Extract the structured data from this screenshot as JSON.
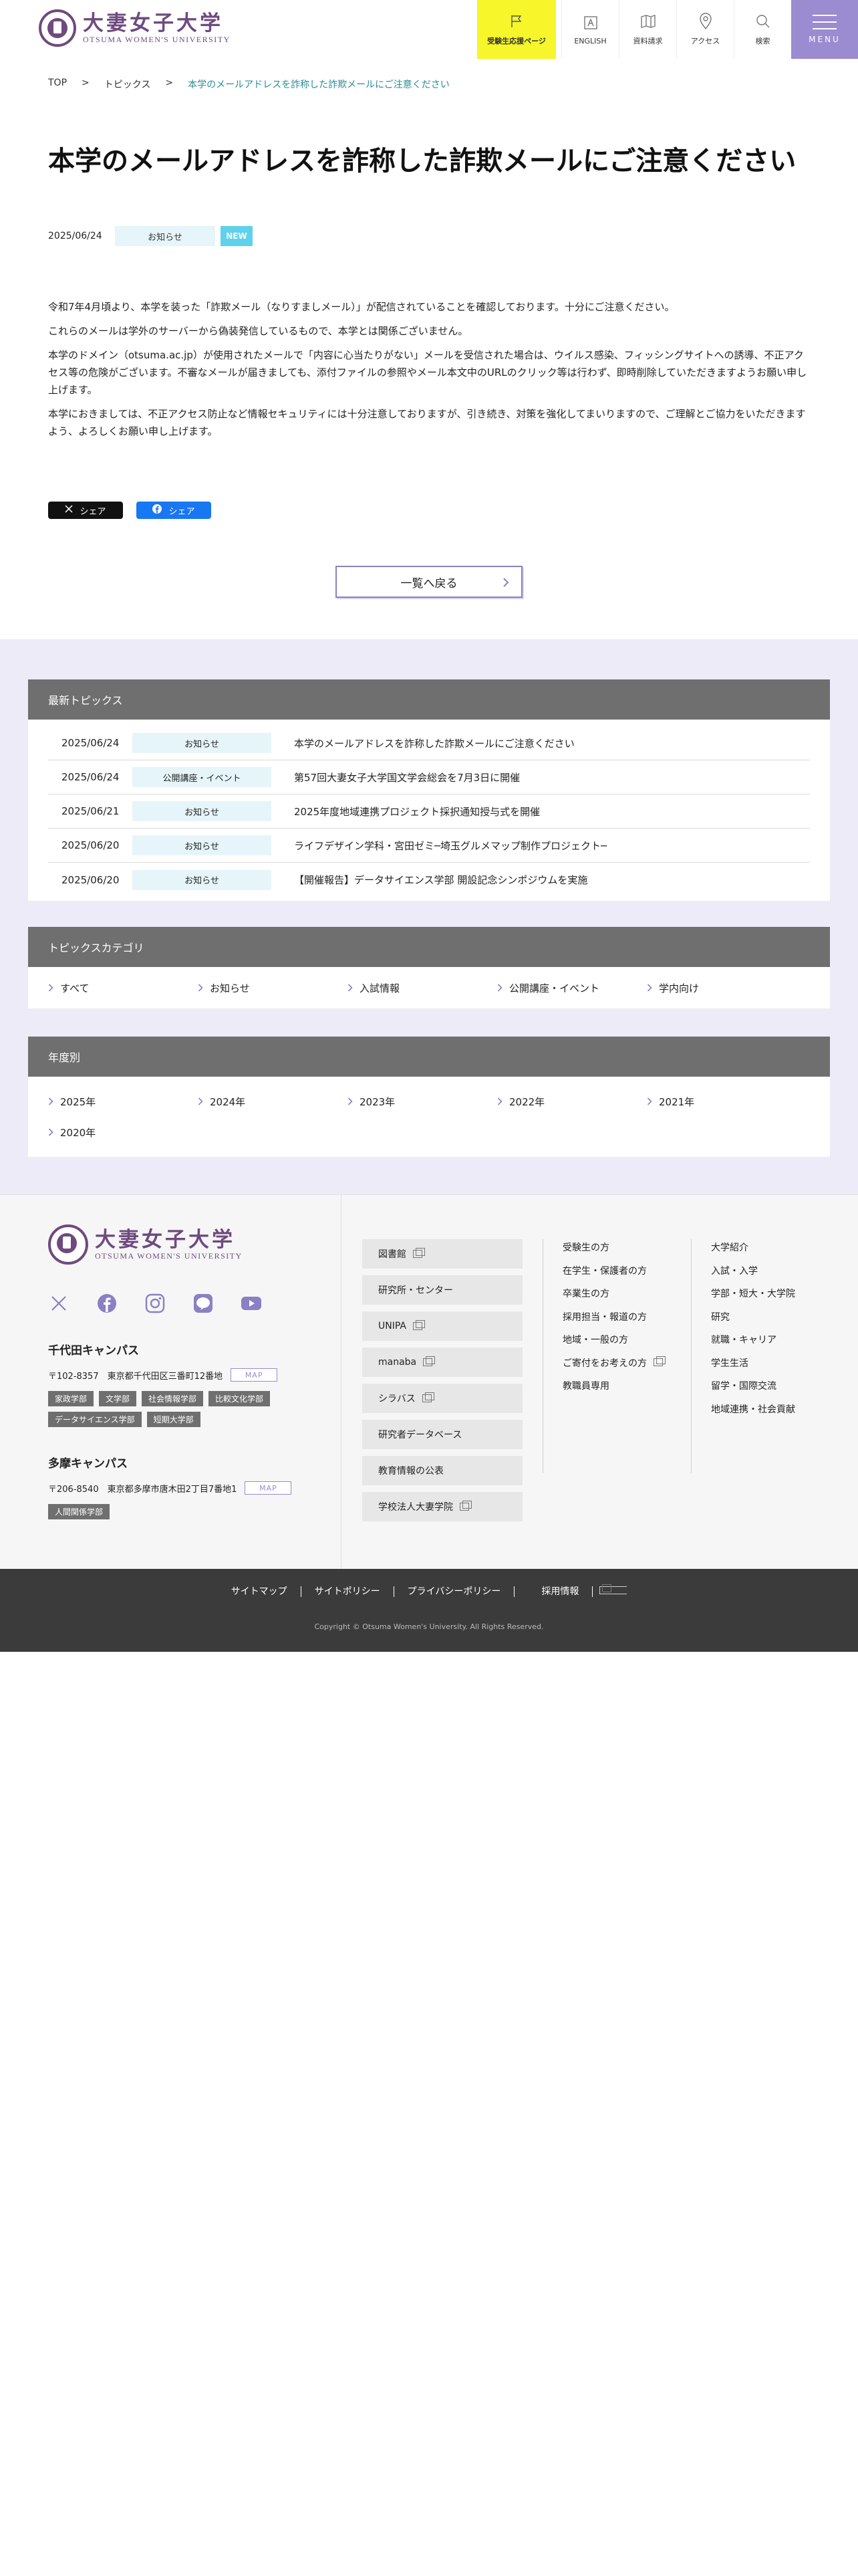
{
  "header": {
    "logo_jp": "大妻女子大学",
    "logo_en": "OTSUMA WOMEN'S UNIVERSITY",
    "nav": [
      {
        "label": "受験生応援ページ",
        "icon": "flag-icon"
      },
      {
        "label": "ENGLISH",
        "icon": "language-icon"
      },
      {
        "label": "資料請求",
        "icon": "brochure-icon"
      },
      {
        "label": "アクセス",
        "icon": "map-pin-icon"
      },
      {
        "label": "検索",
        "icon": "search-icon"
      }
    ],
    "menu_label": "MENU"
  },
  "breadcrumb": {
    "items": [
      "TOP",
      "トピックス",
      "本学のメールアドレスを詐称した詐欺メールにご注意ください"
    ],
    "separator": ">"
  },
  "article": {
    "title": "本学のメールアドレスを詐称した詐欺メールにご注意ください",
    "date": "2025/06/24",
    "category": "お知らせ",
    "new_badge": "NEW",
    "paragraphs": [
      "令和7年4月頃より、本学を装った「詐欺メール（なりすましメール）」が配信されていることを確認しております。十分にご注意ください。",
      "これらのメールは学外のサーバーから偽装発信しているもので、本学とは関係ございません。",
      "本学のドメイン（otsuma.ac.jp）が使用されたメールで「内容に心当たりがない」メールを受信された場合は、ウイルス感染、フィッシングサイトへの誘導、不正アクセス等の危険がございます。不審なメールが届きましても、添付ファイルの参照やメール本文中のURLのクリック等は行わず、即時削除していただきますようお願い申し上げます。",
      "本学におきましては、不正アクセス防止など情報セキュリティには十分注意しておりますが、引き続き、対策を強化してまいりますので、ご理解とご協力をいただきますよう、よろしくお願い申し上げます。"
    ],
    "share_x": "シェア",
    "share_fb": "シェア",
    "back_label": "一覧へ戻る"
  },
  "latest": {
    "heading": "最新トピックス",
    "items": [
      {
        "date": "2025/06/24",
        "category": "お知らせ",
        "title": "本学のメールアドレスを詐称した詐欺メールにご注意ください"
      },
      {
        "date": "2025/06/24",
        "category": "公開講座・イベント",
        "title": "第57回大妻女子大学国文学会総会を7月3日に開催"
      },
      {
        "date": "2025/06/21",
        "category": "お知らせ",
        "title": "2025年度地域連携プロジェクト採択通知授与式を開催"
      },
      {
        "date": "2025/06/20",
        "category": "お知らせ",
        "title": "ライフデザイン学科・宮田ゼミ─埼玉グルメマップ制作プロジェクト─"
      },
      {
        "date": "2025/06/20",
        "category": "お知らせ",
        "title": "【開催報告】データサイエンス学部 開設記念シンポジウムを実施"
      }
    ]
  },
  "categories": {
    "heading": "トピックスカテゴリ",
    "items": [
      "すべて",
      "お知らせ",
      "入試情報",
      "公開講座・イベント",
      "学内向け"
    ]
  },
  "years": {
    "heading": "年度別",
    "items": [
      "2025年",
      "2024年",
      "2023年",
      "2022年",
      "2021年",
      "2020年"
    ]
  },
  "footer": {
    "logo_jp": "大妻女子大学",
    "logo_en": "OTSUMA WOMEN'S UNIVERSITY",
    "social": [
      "x-icon",
      "facebook-icon",
      "instagram-icon",
      "line-icon",
      "youtube-icon"
    ],
    "campus1": {
      "name": "千代田キャンパス",
      "address": "〒102-8357　東京都千代田区三番町12番地",
      "map": "MAP",
      "tags": [
        "家政学部",
        "文学部",
        "社会情報学部",
        "比較文化学部",
        "データサイエンス学部",
        "短期大学部"
      ]
    },
    "campus2": {
      "name": "多摩キャンパス",
      "address": "〒206-8540　東京都多摩市唐木田2丁目7番地1",
      "map": "MAP",
      "tags": [
        "人間関係学部"
      ]
    },
    "buttons": [
      {
        "label": "図書館",
        "external": true
      },
      {
        "label": "研究所・センター",
        "external": false
      },
      {
        "label": "UNIPA",
        "external": true
      },
      {
        "label": "manaba",
        "external": true
      },
      {
        "label": "シラバス",
        "external": true
      },
      {
        "label": "研究者データベース",
        "external": false
      },
      {
        "label": "教育情報の公表",
        "external": false
      },
      {
        "label": "学校法人大妻学院",
        "external": true
      }
    ],
    "col1": [
      "受験生の方",
      "在学生・保護者の方",
      "卒業生の方",
      "採用担当・報道の方",
      "地域・一般の方",
      "ご寄付をお考えの方",
      "教職員専用"
    ],
    "col2": [
      "大学紹介",
      "入試・入学",
      "学部・短大・大学院",
      "研究",
      "就職・キャリア",
      "学生生活",
      "留学・国際交流",
      "地域連携・社会貢献"
    ]
  },
  "bottom": {
    "links": [
      "サイトマップ",
      "サイトポリシー",
      "プライバシーポリシー",
      "採用情報"
    ],
    "copyright": "Copyright © Otsuma Women's University.  All Rights Reserved."
  }
}
